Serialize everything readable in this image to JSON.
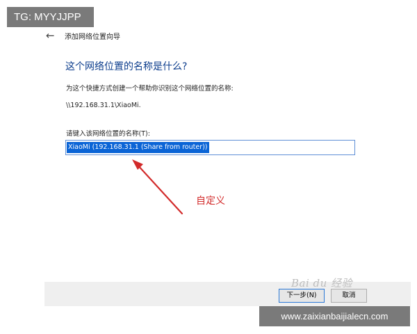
{
  "watermark_top": "TG: MYYJJPP",
  "watermark_bottom": "www.zaixianbaijialecn.com",
  "watermark_mid": "Bai du 经验",
  "wizard": {
    "back_icon": "←",
    "title": "添加网络位置向导",
    "heading": "这个网络位置的名称是什么?",
    "description": "为这个快捷方式创建一个帮助你识别这个网络位置的名称:",
    "path": "\\\\192.168.31.1\\XiaoMi.",
    "input_label": "请键入该网络位置的名称(T):",
    "input_value": "XiaoMi (192.168.31.1 (Share from router))",
    "next_button": "下一步(N)",
    "cancel_button": "取消"
  },
  "annotation": {
    "text": "自定义",
    "color": "#d22a2a"
  }
}
